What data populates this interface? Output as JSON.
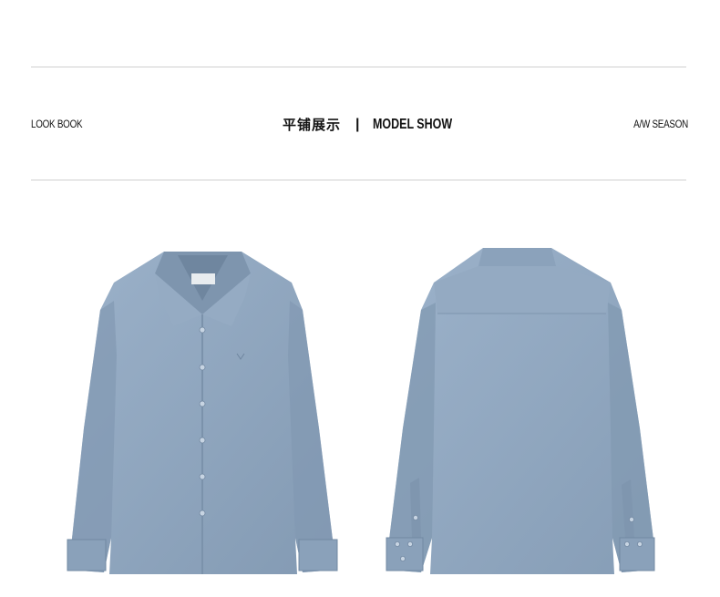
{
  "header": {
    "left_label": "LOOK BOOK",
    "center_cn": "平铺展示",
    "separator": "|",
    "center_en": "MODEL SHOW",
    "right_label": "A/W SEASON"
  },
  "colors": {
    "shirt": "#8fa6bf",
    "shirt_shadow": "#7a91aa",
    "rule": "#cfcfcf"
  },
  "images": {
    "front": "shirt-front",
    "back": "shirt-back"
  }
}
